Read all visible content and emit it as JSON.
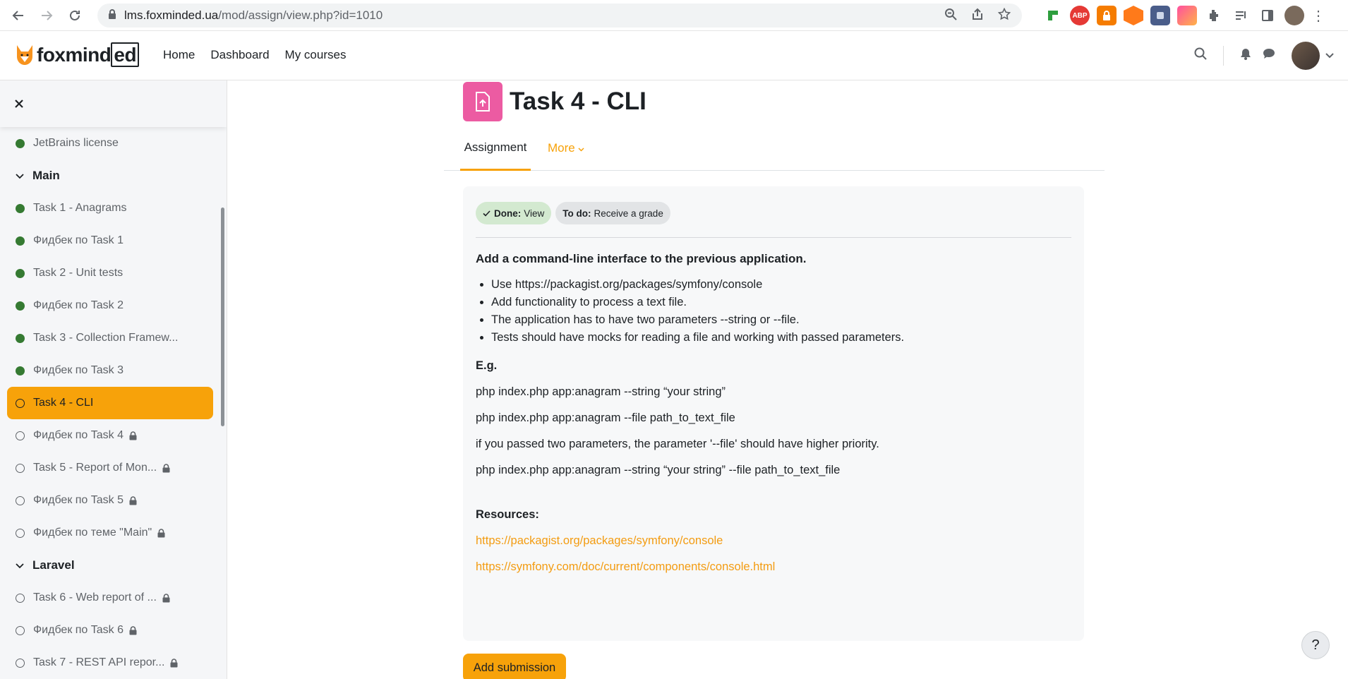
{
  "browser": {
    "url_host": "lms.foxminded.ua",
    "url_path": "/mod/assign/view.php?id=1010"
  },
  "header": {
    "logo_text": "foxmind",
    "logo_text_boxed": "ed",
    "nav": [
      "Home",
      "Dashboard",
      "My courses"
    ]
  },
  "drawer": {
    "items": [
      {
        "type": "item",
        "label": "JetBrains license",
        "status": "done",
        "locked": false
      },
      {
        "type": "section",
        "label": "Main"
      },
      {
        "type": "item",
        "label": "Task 1 - Anagrams",
        "status": "done",
        "locked": false
      },
      {
        "type": "item",
        "label": "Фидбек по Task 1",
        "status": "done",
        "locked": false
      },
      {
        "type": "item",
        "label": "Task 2 - Unit tests",
        "status": "done",
        "locked": false
      },
      {
        "type": "item",
        "label": "Фидбек по Task 2",
        "status": "done",
        "locked": false
      },
      {
        "type": "item",
        "label": "Task 3 - Collection Framew...",
        "status": "done",
        "locked": false
      },
      {
        "type": "item",
        "label": "Фидбек по Task 3",
        "status": "done",
        "locked": false
      },
      {
        "type": "item",
        "label": "Task 4 - CLI",
        "status": "active",
        "locked": false
      },
      {
        "type": "item",
        "label": "Фидбек по Task 4",
        "status": "todo",
        "locked": true
      },
      {
        "type": "item",
        "label": "Task 5 - Report of Mon...",
        "status": "todo",
        "locked": true
      },
      {
        "type": "item",
        "label": "Фидбек по Task 5",
        "status": "todo",
        "locked": true
      },
      {
        "type": "item",
        "label": "Фидбек по теме \"Main\"",
        "status": "todo",
        "locked": true
      },
      {
        "type": "section",
        "label": "Laravel"
      },
      {
        "type": "item",
        "label": "Task 6 - Web report of ...",
        "status": "todo",
        "locked": true
      },
      {
        "type": "item",
        "label": "Фидбек по Task 6",
        "status": "todo",
        "locked": true
      },
      {
        "type": "item",
        "label": "Task 7 - REST API repor...",
        "status": "todo",
        "locked": true
      }
    ]
  },
  "page": {
    "title": "Task 4 - CLI",
    "tabs": {
      "assignment": "Assignment",
      "more": "More"
    },
    "badges": {
      "done_label": "Done:",
      "done_value": "View",
      "todo_label": "To do:",
      "todo_value": "Receive a grade"
    },
    "intro": "Add a command-line interface to the previous application.",
    "bullets": [
      "Use https://packagist.org/packages/symfony/console",
      "Add functionality to process a text file.",
      "The application has to have two parameters --string or --file.",
      "Tests should have mocks for reading a file and working with passed parameters."
    ],
    "eg_heading": "E.g.",
    "examples": [
      "php index.php app:anagram --string “your string”",
      "php index.php app:anagram --file path_to_text_file",
      "if you passed two parameters, the parameter '--file' should have higher priority.",
      "php index.php app:anagram  --string “your string” --file path_to_text_file"
    ],
    "resources_heading": "Resources:",
    "links": [
      "https://packagist.org/packages/symfony/console",
      "https://symfony.com/doc/current/components/console.html"
    ],
    "submit_label": "Add submission",
    "help_label": "?"
  },
  "colors": {
    "accent": "#f7a20a",
    "done_dot": "#357a32",
    "activity_icon": "#ec5ba2"
  }
}
